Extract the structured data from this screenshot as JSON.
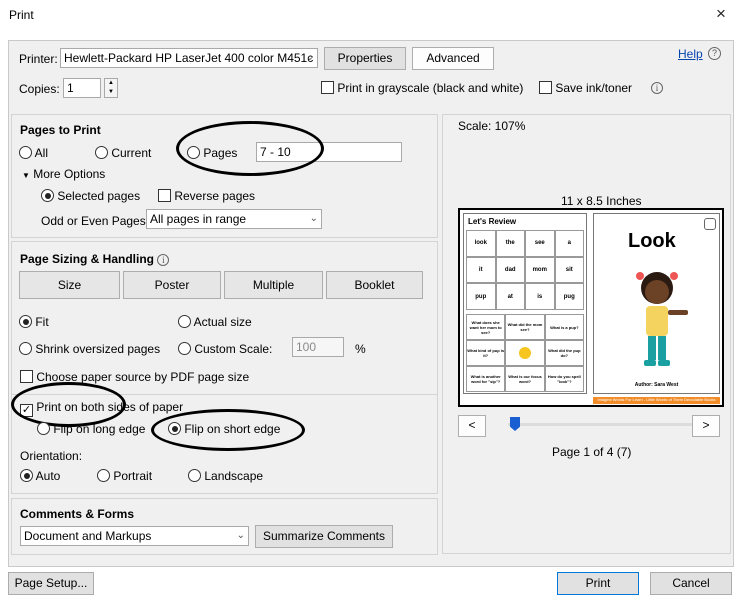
{
  "window": {
    "title": "Print",
    "close_glyph": "×"
  },
  "printer": {
    "label": "Printer:",
    "value": "Hewlett-Packard HP LaserJet 400 color M451c",
    "properties": "Properties",
    "advanced": "Advanced",
    "help": "Help",
    "help_icon": "?"
  },
  "copies": {
    "label": "Copies:",
    "value": "1",
    "grayscale": "Print in grayscale (black and white)",
    "save_ink": "Save ink/toner",
    "info_icon": "i"
  },
  "pages_to_print": {
    "heading": "Pages to Print",
    "all": "All",
    "current": "Current",
    "pages": "Pages",
    "pages_value": "7 - 10",
    "more_options": "More Options",
    "more_arrow": "▼",
    "selected_pages": "Selected pages",
    "reverse_pages": "Reverse pages",
    "odd_even_label": "Odd or Even Pages:",
    "odd_even_value": "All pages in range"
  },
  "sizing": {
    "heading": "Page Sizing & Handling",
    "info_icon": "i",
    "buttons": [
      "Size",
      "Poster",
      "Multiple",
      "Booklet"
    ],
    "fit": "Fit",
    "actual_size": "Actual size",
    "shrink": "Shrink oversized pages",
    "custom_scale": "Custom Scale:",
    "custom_scale_value": "100",
    "percent": "%",
    "choose_source": "Choose paper source by PDF page size",
    "both_sides": "Print on both sides of paper",
    "flip_long": "Flip on long edge",
    "flip_short": "Flip on short edge",
    "check_glyph": "✓"
  },
  "orientation": {
    "label": "Orientation:",
    "auto": "Auto",
    "portrait": "Portrait",
    "landscape": "Landscape"
  },
  "comments": {
    "heading": "Comments & Forms",
    "value": "Document and Markups",
    "summarize": "Summarize Comments"
  },
  "preview": {
    "scale": "Scale: 107%",
    "paper_size": "11 x 8.5 Inches",
    "prev": "<",
    "next": ">",
    "page_info": "Page 1 of 4 (7)",
    "left_page": {
      "title": "Let's Review",
      "words": [
        "look",
        "the",
        "see",
        "a",
        "it",
        "dad",
        "mom",
        "sit",
        "pup",
        "at",
        "is",
        "pug"
      ],
      "questions": [
        "What does she want her mom to see?",
        "What did the mom see?",
        "What is a pup?",
        "What kind of pup is it?",
        "",
        "What did the pup do?",
        "What is another word for \"sip\"?",
        "What is our focus word?",
        "How do you spell \"look\"?"
      ],
      "footer": "Imagine Words For Learn - Little Words of Them Decodable Books"
    },
    "right_page": {
      "title": "Look",
      "author": "Author: Sara West"
    }
  },
  "footer": {
    "page_setup": "Page Setup...",
    "print": "Print",
    "cancel": "Cancel"
  },
  "colors": {
    "panel_bg": "#f0f0f0",
    "accent": "#1a5fd1",
    "link": "#0645ad",
    "footer_orange": "#f28c28"
  }
}
